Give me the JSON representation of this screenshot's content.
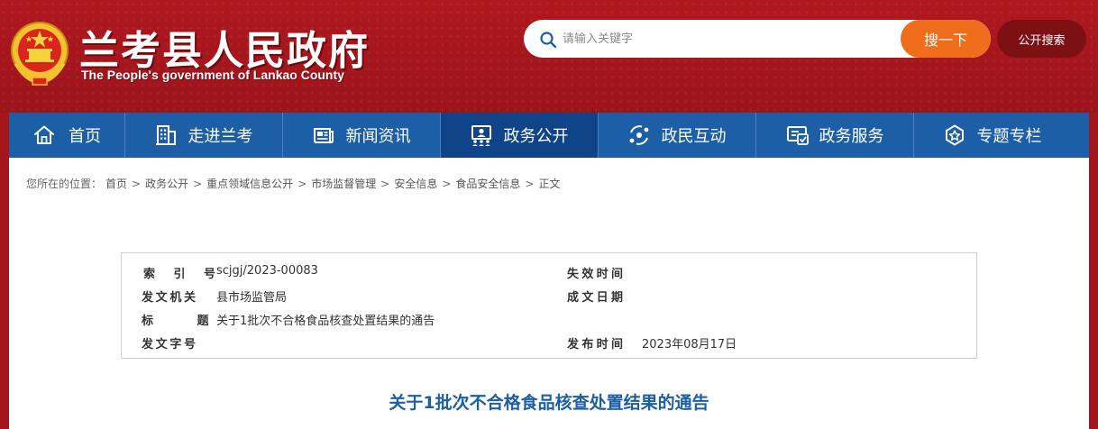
{
  "header": {
    "site_title": "兰考县人民政府",
    "site_subtitle": "The People's government of Lankao County",
    "search_placeholder": "请输入关键字",
    "search_button": "搜一下",
    "public_search_button": "公开搜索"
  },
  "nav": {
    "items": [
      {
        "label": "首页",
        "icon": "home-icon"
      },
      {
        "label": "走进兰考",
        "icon": "building-icon"
      },
      {
        "label": "新闻资讯",
        "icon": "newspaper-icon"
      },
      {
        "label": "政务公开",
        "icon": "people-board-icon",
        "active": true
      },
      {
        "label": "政民互动",
        "icon": "interaction-icon"
      },
      {
        "label": "政务服务",
        "icon": "service-icon"
      },
      {
        "label": "专题专栏",
        "icon": "badge-icon"
      }
    ]
  },
  "breadcrumb": {
    "prefix": "您所在的位置：",
    "items": [
      "首页",
      "政务公开",
      "重点领域信息公开",
      "市场监督管理",
      "安全信息",
      "食品安全信息"
    ],
    "current": "正文",
    "separator": ">"
  },
  "meta": {
    "index_label": "索 引 号",
    "index_value": "scjgj/2023-00083",
    "expire_label": "失效时间",
    "expire_value": "",
    "issuer_label": "发文机关",
    "issuer_value": "县市场监管局",
    "created_label": "成文日期",
    "created_value": "",
    "title_label": "标 题",
    "title_value": "关于1批次不合格食品核查处置结果的通告",
    "docno_label": "发文字号",
    "docno_value": "",
    "publish_label": "发布时间",
    "publish_value": "2023年08月17日"
  },
  "article": {
    "title": "关于1批次不合格食品核查处置结果的通告"
  },
  "colors": {
    "header_red": "#a3161c",
    "nav_blue": "#1c5fa6",
    "nav_active": "#0f4588",
    "search_orange": "#ef6d1b",
    "title_blue": "#1c5fa6"
  }
}
